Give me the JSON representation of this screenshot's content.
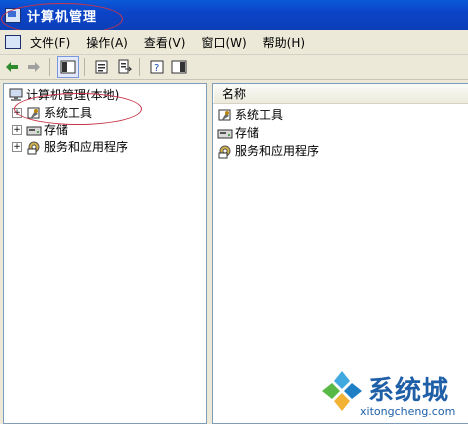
{
  "window": {
    "title": "计算机管理"
  },
  "menubar": {
    "items": [
      "文件(F)",
      "操作(A)",
      "查看(V)",
      "窗口(W)",
      "帮助(H)"
    ]
  },
  "toolbar": {
    "buttons": [
      "back-arrow-icon",
      "forward-arrow-icon",
      "show-hide-tree-icon",
      "properties-icon",
      "export-list-icon",
      "help-icon",
      "action-pane-icon"
    ]
  },
  "tree": {
    "root": "计算机管理(本地)",
    "children": [
      {
        "label": "系统工具",
        "icon": "tools-icon"
      },
      {
        "label": "存储",
        "icon": "storage-icon"
      },
      {
        "label": "服务和应用程序",
        "icon": "services-icon"
      }
    ]
  },
  "list": {
    "column": "名称",
    "items": [
      {
        "label": "系统工具",
        "icon": "tools-icon"
      },
      {
        "label": "存储",
        "icon": "storage-icon"
      },
      {
        "label": "服务和应用程序",
        "icon": "services-icon"
      }
    ]
  },
  "watermark": {
    "brand": "系统城",
    "url": "xitongcheng.com"
  },
  "colors": {
    "titlebar": "#0c44c8",
    "annotation": "#c8344a",
    "brand": "#1f5fa8"
  }
}
